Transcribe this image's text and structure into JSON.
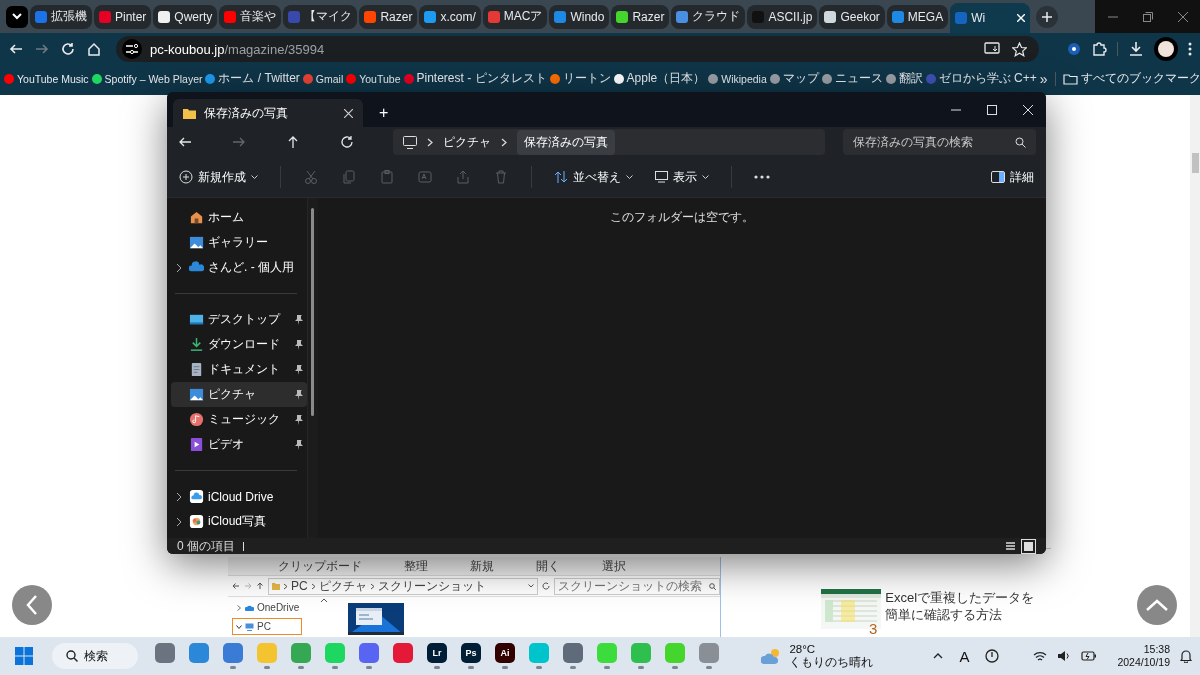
{
  "browser": {
    "tabs": [
      {
        "label": "拡張機",
        "color": "#1a73e8",
        "selected": false
      },
      {
        "label": "Pinter",
        "color": "#e60023",
        "selected": false
      },
      {
        "label": "Qwerty",
        "color": "#f0f0f0",
        "selected": false
      },
      {
        "label": "音楽や",
        "color": "#ff0000",
        "selected": false
      },
      {
        "label": "【マイク",
        "color": "#3949ab",
        "selected": false
      },
      {
        "label": "Razer",
        "color": "#ff4500",
        "selected": false
      },
      {
        "label": "x.com/",
        "color": "#1d9bf0",
        "selected": false
      },
      {
        "label": "MACア",
        "color": "#e53935",
        "selected": false
      },
      {
        "label": "Windo",
        "color": "#1e88e5",
        "selected": false
      },
      {
        "label": "Razer",
        "color": "#44d62c",
        "selected": false
      },
      {
        "label": "クラウド",
        "color": "#4a90e2",
        "selected": false
      },
      {
        "label": "ASCII.jp",
        "color": "#111111",
        "selected": false
      },
      {
        "label": "Geekor",
        "color": "#cfd8dc",
        "selected": false
      },
      {
        "label": "MEGA",
        "color": "#1e88e5",
        "selected": false
      },
      {
        "label": "Wi",
        "color": "#1565c0",
        "selected": true
      }
    ],
    "nav": [
      {
        "disabled": false
      },
      {
        "disabled": true
      },
      {
        "disabled": false
      },
      {
        "disabled": false
      }
    ],
    "address": {
      "host": "pc-koubou.jp",
      "path": "/magazine/35994"
    },
    "bookmarks": [
      {
        "label": "YouTube Music",
        "color": "#ff0000"
      },
      {
        "label": "Spotify – Web Player",
        "color": "#1ed760"
      },
      {
        "label": "ホーム / Twitter",
        "color": "#1d9bf0"
      },
      {
        "label": "Gmail",
        "color": "#ea4335"
      },
      {
        "label": "YouTube",
        "color": "#ff0000"
      },
      {
        "label": "Pinterest - ピンタレスト",
        "color": "#e60023"
      },
      {
        "label": "リートン",
        "color": "#ff6d00"
      },
      {
        "label": "Apple（日本）",
        "color": "#ffffff"
      },
      {
        "label": "Wikipedia",
        "color": "#9aa0a6"
      },
      {
        "label": "マップ",
        "color": "#9aa0a6"
      },
      {
        "label": "ニュース",
        "color": "#9aa0a6"
      },
      {
        "label": "翻訳",
        "color": "#9aa0a6"
      },
      {
        "label": "ゼロから学ぶ C++",
        "color": "#3f51b5"
      }
    ],
    "more": "»",
    "all_bookmarks": "すべてのブックマーク"
  },
  "explorer": {
    "tab_title": "保存済みの写真",
    "new_tab": "+",
    "nav": [
      {
        "disabled": false
      },
      {
        "disabled": true
      },
      {
        "disabled": false
      },
      {
        "disabled": false
      }
    ],
    "breadcrumb": [
      "ピクチャ",
      "保存済みの写真"
    ],
    "search": {
      "placeholder": "保存済みの写真の検索"
    },
    "toolbar": {
      "new": "新規作成",
      "actions": [
        {
          "disabled": true
        },
        {
          "disabled": true
        },
        {
          "disabled": true
        },
        {
          "disabled": true
        },
        {
          "disabled": true
        },
        {
          "disabled": true
        }
      ],
      "sort": "並べ替え",
      "view": "表示",
      "details": "詳細"
    },
    "sidebar": [
      {
        "items": [
          {
            "label": "ホーム",
            "expandable": false,
            "pinned": false,
            "selected": false
          },
          {
            "label": "ギャラリー",
            "expandable": false,
            "pinned": false,
            "selected": false
          },
          {
            "label": "さんど. - 個人用",
            "expandable": true,
            "pinned": false,
            "selected": false
          }
        ]
      },
      {
        "items": [
          {
            "label": "デスクトップ",
            "expandable": false,
            "pinned": true,
            "selected": false
          },
          {
            "label": "ダウンロード",
            "expandable": false,
            "pinned": true,
            "selected": false
          },
          {
            "label": "ドキュメント",
            "expandable": false,
            "pinned": true,
            "selected": false
          },
          {
            "label": "ピクチャ",
            "expandable": false,
            "pinned": true,
            "selected": true
          },
          {
            "label": "ミュージック",
            "expandable": false,
            "pinned": true,
            "selected": false
          },
          {
            "label": "ビデオ",
            "expandable": false,
            "pinned": true,
            "selected": false
          }
        ]
      },
      {
        "items": [
          {
            "label": "iCloud Drive",
            "expandable": true,
            "pinned": false,
            "selected": false
          },
          {
            "label": "iCloud写真",
            "expandable": true,
            "pinned": false,
            "selected": false
          }
        ]
      }
    ],
    "empty_message": "このフォルダーは空です。",
    "status": "0 個の項目",
    "view_modes": [
      {
        "selected": false
      },
      {
        "selected": true
      }
    ]
  },
  "page": {
    "inset": {
      "ribbon": [
        "クリップボード",
        "整理",
        "新規",
        "開く",
        "選択"
      ],
      "path": [
        "PC",
        "ピクチャ",
        "スクリーンショット"
      ],
      "search": {
        "placeholder": "スクリーンショットの検索"
      },
      "tree": [
        {
          "label": "OneDrive",
          "expanded": false,
          "selected": false
        },
        {
          "label": "PC",
          "expanded": true,
          "selected": true
        }
      ]
    },
    "article": {
      "rank": "3",
      "title": "Excelで重複したデータを簡単に確認する方法"
    }
  },
  "taskbar": {
    "search": "検索",
    "apps": [
      {
        "color": "#6b7280",
        "running": false
      },
      {
        "color": "#2b88d8",
        "running": false
      },
      {
        "color": "#3a7bd5",
        "running": true
      },
      {
        "color": "#f4c430",
        "running": true
      },
      {
        "color": "#34a853",
        "running": true
      },
      {
        "color": "#1ed760",
        "running": true
      },
      {
        "color": "#5865f2",
        "running": true
      },
      {
        "color": "#e31937",
        "running": false
      },
      {
        "label": "Lr",
        "color": "#001e36",
        "running": true
      },
      {
        "label": "Ps",
        "color": "#001e36",
        "running": true
      },
      {
        "label": "Ai",
        "color": "#330000",
        "running": true
      },
      {
        "color": "#00c4cc",
        "running": true
      },
      {
        "color": "#5f6b7a",
        "running": true
      },
      {
        "color": "#3ddc3d",
        "running": true
      },
      {
        "color": "#2fbf4f",
        "running": true
      },
      {
        "color": "#44d62c",
        "running": true
      },
      {
        "color": "#8a8f96",
        "running": true
      }
    ],
    "weather": {
      "temp": "28°C",
      "desc": "くもりのち晴れ"
    },
    "ime": "A",
    "time": "15:38",
    "date": "2024/10/19"
  }
}
